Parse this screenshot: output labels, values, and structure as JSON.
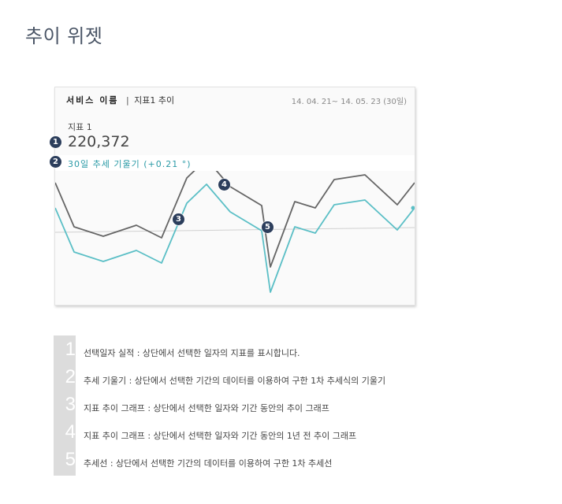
{
  "page": {
    "title": "추이 위젯"
  },
  "widget": {
    "service_name": "서비스 이름",
    "separator": "|",
    "metric_sub": "지표1 추이",
    "date_range": "14. 04. 21~ 14. 05. 23 (30일)",
    "metric_label": "지표 1",
    "metric_value": "220,372",
    "slope_label": "30일 추세 기울기 (+0.21 °)"
  },
  "chart_data": {
    "type": "line",
    "x": [
      1,
      2,
      3,
      4,
      5,
      6,
      7,
      8,
      9,
      10,
      11,
      12,
      13,
      14,
      15
    ],
    "series": [
      {
        "values": [
          231,
          287,
          299,
          285,
          301,
          225,
          201,
          236,
          260,
          338,
          255,
          263,
          227,
          221,
          259,
          231
        ],
        "color": "#666666"
      },
      {
        "values": [
          263,
          319,
          331,
          317,
          333,
          257,
          233,
          268,
          292,
          370,
          287,
          295,
          259,
          253,
          291,
          263
        ],
        "color": "#5bbfc6"
      },
      {
        "values": [
          294,
          288
        ],
        "color": "#d0d0d0"
      }
    ],
    "note": "values are approximate readouts of line heights"
  },
  "badges": [
    "1",
    "2",
    "3",
    "4",
    "5"
  ],
  "legend": {
    "items": [
      {
        "num": "1",
        "text": "선택일자 실적 : 상단에서 선택한 일자의 지표를 표시합니다."
      },
      {
        "num": "2",
        "text": "추세 기울기 : 상단에서 선택한 기간의 데이터를 이용하여 구한 1차 추세식의 기울기"
      },
      {
        "num": "3",
        "text": "지표 추이 그래프 : 상단에서 선택한 일자와 기간 동안의 추이 그래프"
      },
      {
        "num": "4",
        "text": "지표 추이 그래프 : 상단에서 선택한 일자와 기간 동안의 1년 전 추이 그래프"
      },
      {
        "num": "5",
        "text": "추세선 : 상단에서 선택한 기간의 데이터를 이용하여 구한 1차 추세선"
      }
    ]
  },
  "colors": {
    "current_line": "#5bbfc6",
    "prev_year_line": "#666666",
    "trend_line": "#d0d0d0",
    "badge": "#2c3e5c",
    "slope_text": "#2a9aa6"
  }
}
